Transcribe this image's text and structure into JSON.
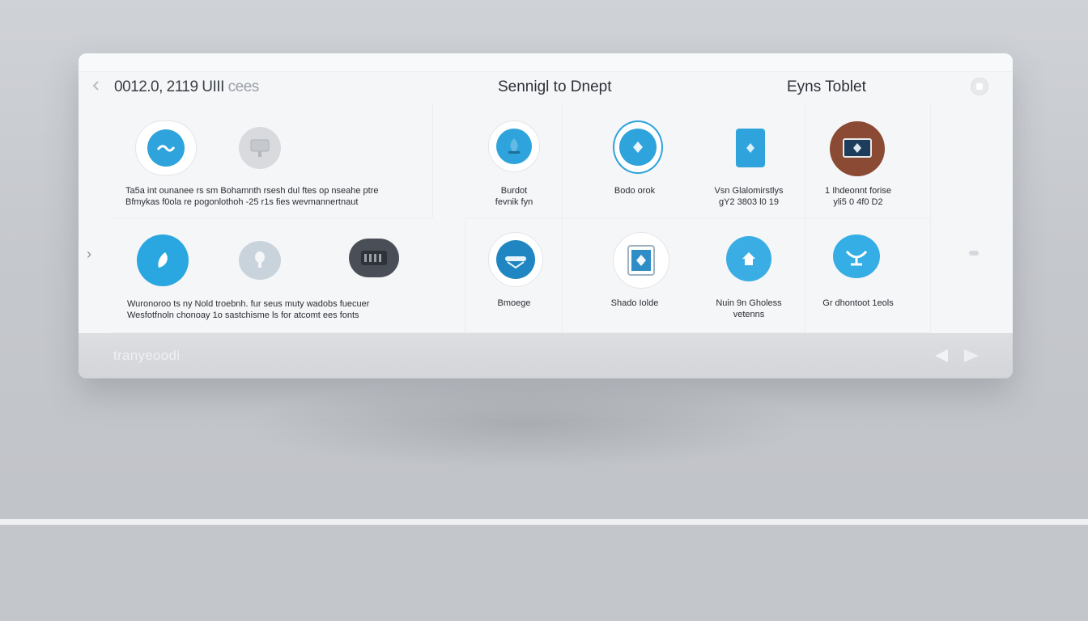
{
  "window": {
    "app_title": "0012.0, 2119 UIII",
    "app_title_suffix": " cees",
    "center_title": "Sennigl to Dnept",
    "right_title": "Eyns Toblet"
  },
  "grid": {
    "row1": [
      {
        "id": "r1c1",
        "label_lines": [
          "Ta5a int  ounanee rs sm Bohamnth rsesh dul ftes op nseahe ptre"
        ]
      },
      {
        "id": "r1c2",
        "label_lines": [
          "Bfmykas  f0ola re pogonlothoh -25 r1s fies wevmannertnaut"
        ]
      },
      {
        "id": "r1c4",
        "label_lines": [
          "Burdot",
          "fevnik fyn"
        ]
      },
      {
        "id": "r1c5",
        "label_lines": [
          "Bodo orok"
        ]
      },
      {
        "id": "r1c6",
        "label_lines": [
          "Vsn Glalomirstlys",
          "gY2 3803 l0 19"
        ]
      },
      {
        "id": "r1c7",
        "label_lines": [
          "1 Ihdeonnt forise",
          "yli5 0 4f0 D2"
        ]
      }
    ],
    "row2": [
      {
        "id": "r2c1",
        "label_lines": [
          "Wuronoroo ts ny Nold troebnh. fur seus muty wadobs fuecuer",
          "Wesfotfnoln chonoay 1o sastchisme ls for atcomt ees fonts"
        ]
      },
      {
        "id": "r2c4",
        "label_lines": [
          "Bmoege"
        ]
      },
      {
        "id": "r2c5",
        "label_lines": [
          "Shado Iolde"
        ]
      },
      {
        "id": "r2c6",
        "label_lines": [
          "Nuin 9n Gholess",
          "vetenns"
        ]
      },
      {
        "id": "r2c7",
        "label_lines": [
          "Gr dhontoot 1eols"
        ]
      }
    ]
  },
  "footer": {
    "text": "tranyeoodi"
  },
  "colors": {
    "accent": "#2ea3dc",
    "dark_icon": "#4a4f57",
    "brown_icon": "#8a4a34",
    "window_bg": "#f5f6f8"
  },
  "icons": {
    "r1c1": "mouse-wave-icon",
    "r1c2": "monitor-stand-icon",
    "r1c4": "drop-pin-icon",
    "r1c5": "diamond-ring-icon",
    "r1c6": "tablet-icon",
    "r1c7": "framed-screen-icon",
    "r2c1": "leaf-pen-icon",
    "r2c2": "mic-icon",
    "r2c3": "keyboard-icon",
    "r2c4": "helmet-icon",
    "r2c5": "frame-diamond-icon",
    "r2c6": "home-icon",
    "r2c7": "satellite-dish-icon"
  }
}
